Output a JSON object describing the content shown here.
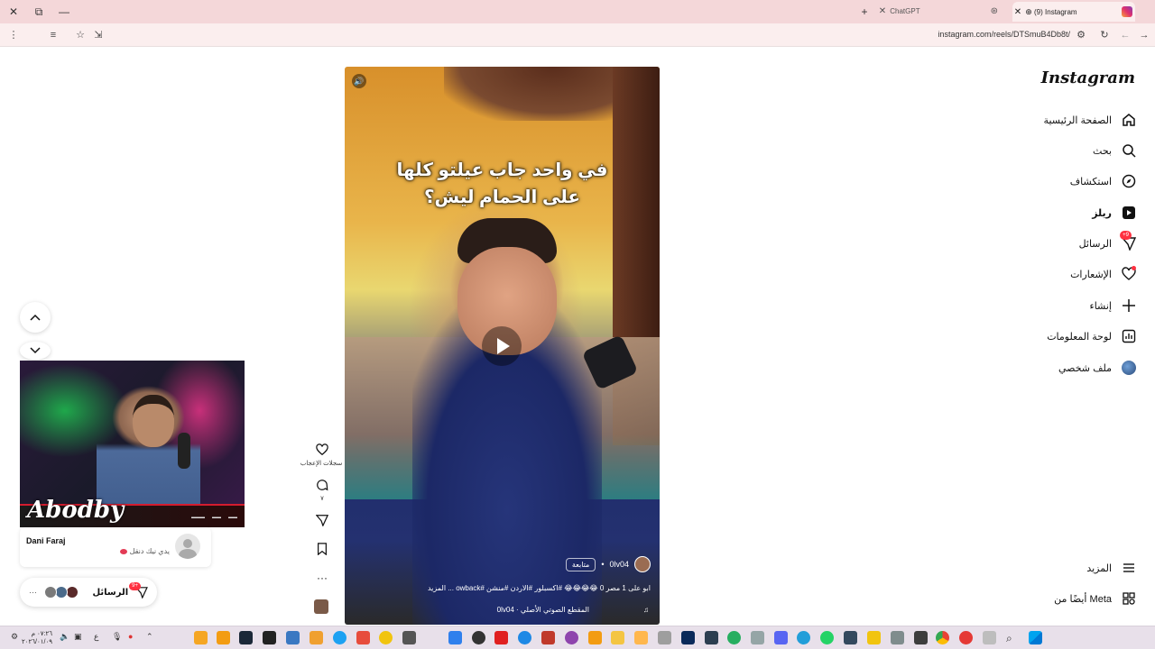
{
  "browser": {
    "tabs": [
      {
        "title": "ChatGPT",
        "active": false
      },
      {
        "title": "(9) Instagram",
        "active": true
      }
    ],
    "url": "instagram.com/reels/DTSmuB4Db8t/"
  },
  "sidebar": {
    "logo": "Instagram",
    "items": [
      {
        "label": "الصفحة الرئيسية",
        "icon": "home-icon"
      },
      {
        "label": "بحث",
        "icon": "search-icon"
      },
      {
        "label": "استكشاف",
        "icon": "explore-compass-icon"
      },
      {
        "label": "ريلز",
        "icon": "reels-icon",
        "active": true
      },
      {
        "label": "الرسائل",
        "icon": "messages-icon",
        "badge": "+9"
      },
      {
        "label": "الإشعارات",
        "icon": "heart-icon",
        "dot": true
      },
      {
        "label": "إنشاء",
        "icon": "plus-icon"
      },
      {
        "label": "لوحة المعلومات",
        "icon": "dashboard-icon"
      },
      {
        "label": "ملف شخصي",
        "icon": "profile-avatar-icon"
      }
    ],
    "more_label": "المزيد",
    "meta_label": "أيضًا من Meta"
  },
  "reel": {
    "overlay_text_line1": "في واحد جاب عيلتو كلها",
    "overlay_text_line2": "على الحمام ليش؟",
    "username": "0lv04",
    "follow_label": "متابعة",
    "caption": "ابو على 1 مصر 0 😂😂😂😂 #اكسبلور #الاردن #منشن #owback ... المزيد",
    "audio_label": "المقطع الصوتي الأصلي · 0lv04"
  },
  "actions": {
    "likes_label": "سجلات الإعجاب",
    "comments_count": "٧"
  },
  "webcam": {
    "streamer_name": "Abodby"
  },
  "notification": {
    "name": "Dani Faraj",
    "message": "يدي نيك دنقل"
  },
  "messages_pill": {
    "label": "الرسائل",
    "badge": "+9"
  },
  "taskbar": {
    "time": "٠٧:٢٦ م",
    "date": "٢٠٢٦/٠١/٠٩",
    "lang": "ع"
  }
}
